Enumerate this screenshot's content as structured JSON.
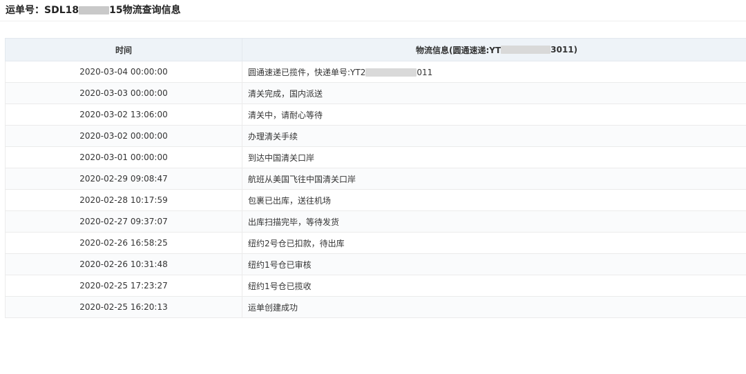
{
  "header": {
    "title_prefix": "运单号：SDL18",
    "title_suffix": "15物流查询信息"
  },
  "table": {
    "columns": {
      "time": "时间",
      "info_prefix": "物流信息(圆通速递:YT",
      "info_suffix": "3011)"
    },
    "rows": [
      {
        "time": "2020-03-04 00:00:00",
        "info_prefix": "圆通速递已揽件，快递单号:YT2",
        "info_suffix": "011",
        "redacted": true
      },
      {
        "time": "2020-03-03 00:00:00",
        "info": "清关完成，国内派送"
      },
      {
        "time": "2020-03-02 13:06:00",
        "info": "清关中，请耐心等待"
      },
      {
        "time": "2020-03-02 00:00:00",
        "info": "办理清关手续"
      },
      {
        "time": "2020-03-01 00:00:00",
        "info": "到达中国清关口岸"
      },
      {
        "time": "2020-02-29 09:08:47",
        "info": "航班从美国飞往中国清关口岸"
      },
      {
        "time": "2020-02-28 10:17:59",
        "info": "包裹已出库，送往机场"
      },
      {
        "time": "2020-02-27 09:37:07",
        "info": "出库扫描完毕，等待发货"
      },
      {
        "time": "2020-02-26 16:58:25",
        "info": "纽约2号仓已扣款，待出库"
      },
      {
        "time": "2020-02-26 10:31:48",
        "info": "纽约1号仓已审核"
      },
      {
        "time": "2020-02-25 17:23:27",
        "info": "纽约1号仓已揽收"
      },
      {
        "time": "2020-02-25 16:20:13",
        "info": "运单创建成功"
      }
    ]
  }
}
